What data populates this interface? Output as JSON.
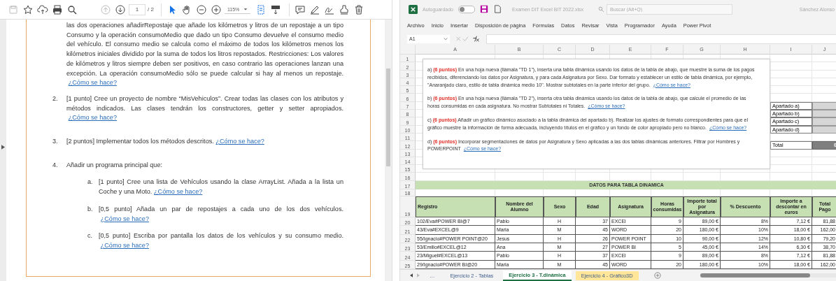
{
  "pdf_viewer": {
    "toolbar": [
      [
        {
          "kind": "save",
          "disabled": true,
          "selected": false
        },
        {
          "kind": "star",
          "disabled": false,
          "selected": false
        },
        {
          "kind": "upload",
          "disabled": false,
          "selected": false
        },
        {
          "kind": "print",
          "disabled": false,
          "selected": false
        },
        {
          "kind": "search",
          "disabled": false,
          "selected": false
        }
      ],
      [
        {
          "kind": "page-up",
          "disabled": true,
          "selected": false
        },
        {
          "kind": "page-down",
          "disabled": false,
          "selected": false
        }
      ],
      [
        {
          "kind": "pointer",
          "disabled": false,
          "selected": true
        },
        {
          "kind": "hand",
          "disabled": false,
          "selected": false
        },
        {
          "kind": "zoom-out",
          "disabled": false,
          "selected": false
        },
        {
          "kind": "zoom-in",
          "disabled": false,
          "selected": false
        }
      ],
      [
        {
          "kind": "fit-page",
          "disabled": false,
          "selected": true
        },
        {
          "kind": "scroll-mode",
          "disabled": false,
          "selected": false
        }
      ],
      [
        {
          "kind": "comment",
          "disabled": false,
          "selected": false
        },
        {
          "kind": "pen",
          "disabled": false,
          "selected": false
        },
        {
          "kind": "sign",
          "disabled": false,
          "selected": false
        },
        {
          "kind": "stamp",
          "disabled": false,
          "selected": false
        },
        {
          "kind": "delete",
          "disabled": false,
          "selected": false
        }
      ]
    ],
    "page_number": "1",
    "page_total": "/ 2",
    "zoom": "115%",
    "paragraph": {
      "text": "las dos operaciones añadirRepostaje que añade los kilómetros y litros de un repostaje a un tipo Consumo y la operación consumoMedio que dado un tipo Consumo devuelve el consumo medio del vehículo. El consumo medio se calcula como el máximo de todos los kilómetros menos los kilómetros iniciales dividido por la suma de todos los litros repostados. Restricciones: Los valores de kilómetros y litros siempre deben ser positivos, en caso contrario las operaciones lanzan una excepción. La operación consumoMedio sólo se puede calcular si hay al menos un repostaje.",
      "link": "¿Cómo se hace?"
    },
    "items": [
      {
        "number": "2.",
        "text": "[1 punto] Cree un proyecto de nombre “MisVehiculos”. Crear todas las clases con los atributos y métodos indicados. Las clases tendrán los constructores, getter y setter apropiados.",
        "link": "¿Cómo se hace?"
      },
      {
        "number": "3.",
        "text": "[2 puntos] Implementar todos los métodos descritos.",
        "link": "¿Cómo se hace?"
      },
      {
        "number": "4.",
        "text": "Añadir un programa principal que:",
        "children": [
          {
            "number": "a.",
            "text": "[1 punto] Cree una lista de Vehículos usando la clase ArrayList. Añada a la lista un Coche y una Moto.",
            "link": "¿Cómo se hace?"
          },
          {
            "number": "b.",
            "text": "[0,5 punto] Añada un par de repostajes a cada uno de los dos vehículos.",
            "link": "¿Cómo se hace?"
          },
          {
            "number": "c.",
            "text": "[0,5 punto] Escriba por pantalla los datos de los vehículos y su consumo medio.",
            "link": "¿Cómo se hace?"
          }
        ]
      }
    ]
  },
  "excel": {
    "title_bar": {
      "autosave_label": "Autoguardado",
      "autosave_on": false,
      "file_name": "Examen DIT Excel BIT 2022.xlsx",
      "search_placeholder": "Buscar (Alt+Q)",
      "user": "Sánchez Alonso"
    },
    "menu": [
      "Archivo",
      "Inicio",
      "Insertar",
      "Disposición de página",
      "Fórmulas",
      "Datos",
      "Revisar",
      "Vista",
      "Programador",
      "Ayuda",
      "Power Pivot"
    ],
    "name_box": "A1",
    "columns": [
      "A",
      "B",
      "C",
      "D",
      "E",
      "F",
      "G",
      "H",
      "I",
      "J"
    ],
    "row_numbers": [
      "1",
      "2",
      "3",
      "4",
      "5",
      "6",
      "7",
      "8",
      "9",
      "10",
      "11",
      "12",
      "13",
      "14",
      "15",
      "16",
      "17",
      "18",
      "19",
      "20",
      "21",
      "22",
      "23",
      "24",
      "25"
    ],
    "instructions": [
      {
        "label": "a)",
        "points": "(6 puntos)",
        "text": "En una hoja nueva (llámala \"TD 1\"), inserta una tabla dinámica usando los datos de la tabla de abajo, que muestre la suma de los pagos recibidos, diferenciando los datos por Asignatura, y para cada Asignatura por Sexo. Dar formato y establecer un estilo de tabla dinámica, por ejemplo, \"Anaranjado claro, estilo de tabla dinámica medio 10\". Mostrar subtotales en la parte inferior del grupo.",
        "link": "¿Cómo se hace?"
      },
      {
        "label": "b)",
        "points": "(6 puntos)",
        "text": "En una hoja nueva (llámala \"TD 2\"), inserta otra tabla dinámica usando los datos de la tabla de abajo, que calcule el promedio de las horas consumidas en cada asignatura. No mostrar Subtotales ni Totales.",
        "link": "¿Cómo se hace?"
      },
      {
        "label": "c)",
        "points": "(6 puntos)",
        "text": "Añadir un gráfico dinámico asociado a la tabla dinámica del apartado b). Realizar los ajustes de formato correspondientes para que el gráfico muestre la información de forma adecuada, incluyendo títulos en el gráfico y un fondo de color apropiado pero no blanco.",
        "link": "¿Cómo se hace?"
      },
      {
        "label": "d)",
        "points": "(6 puntos)",
        "text": "Incorporar segmentaciones de datos por Asignatura y Sexo aplicadas a las dos tablas dinámicas anteriores. Filtrar por Hombres y POWERPOINT",
        "link": "¿Cómo se hace?"
      }
    ],
    "summary": [
      {
        "kind": "item",
        "label": "Apartado a)"
      },
      {
        "kind": "item",
        "label": "Apartado b)"
      },
      {
        "kind": "item",
        "label": "Apartado c)"
      },
      {
        "kind": "item",
        "label": "Apartado d)"
      },
      {
        "kind": "total",
        "label": "Total",
        "value": "0"
      }
    ],
    "table_title": "DATOS PARA TABLA DINAMICA",
    "table": {
      "columns": [
        "Registro",
        "Nombre del Alumno",
        "Sexo",
        "Edad",
        "Asignatura",
        "Horas consumidas",
        "Importe total por Asignatura",
        "% Descuento",
        "Importe a descontar en euros",
        "Total Pago"
      ],
      "rows": [
        [
          "102/Eva#POWER BI@7",
          "Pablo",
          "H",
          "37",
          "EXCEl",
          "9",
          "89,00 €",
          "8%",
          "7,12 €",
          "81,88"
        ],
        [
          "43/Eva#EXCEL@9",
          "Maria",
          "M",
          "45",
          "WORD",
          "20",
          "180,00 €",
          "10%",
          "18,00 €",
          "162,00"
        ],
        [
          "55/Ignacio#POWER POINT@20",
          "Jesus",
          "H",
          "26",
          "POWER POINT",
          "10",
          "90,00 €",
          "12%",
          "10,80 €",
          "79,20"
        ],
        [
          "53/Emilio#EXCEL@12",
          "Ana",
          "M",
          "27",
          "POWER BI",
          "5",
          "45,00 €",
          "14%",
          "6,30 €",
          "38,70"
        ],
        [
          "23/Miguel#EXCEL@13",
          "Pablo",
          "H",
          "37",
          "EXCEl",
          "9",
          "89,00 €",
          "8%",
          "7,12 €",
          "81,88"
        ],
        [
          "29/Ignacio#POWER BI@20",
          "Maria",
          "M",
          "45",
          "WORD",
          "20",
          "180,00 €",
          "10%",
          "18,00 €",
          "162,00"
        ]
      ]
    },
    "sheet_tabs": [
      {
        "label": "…",
        "selected": false
      },
      {
        "label": "Ejercicio 2 - Tablas",
        "selected": false
      },
      {
        "label": "Ejercicio 3 - T.dinámica",
        "selected": true
      },
      {
        "label": "Ejercicio 4 - Gráfico3D",
        "selected": false,
        "color": "#ffe699"
      }
    ]
  }
}
